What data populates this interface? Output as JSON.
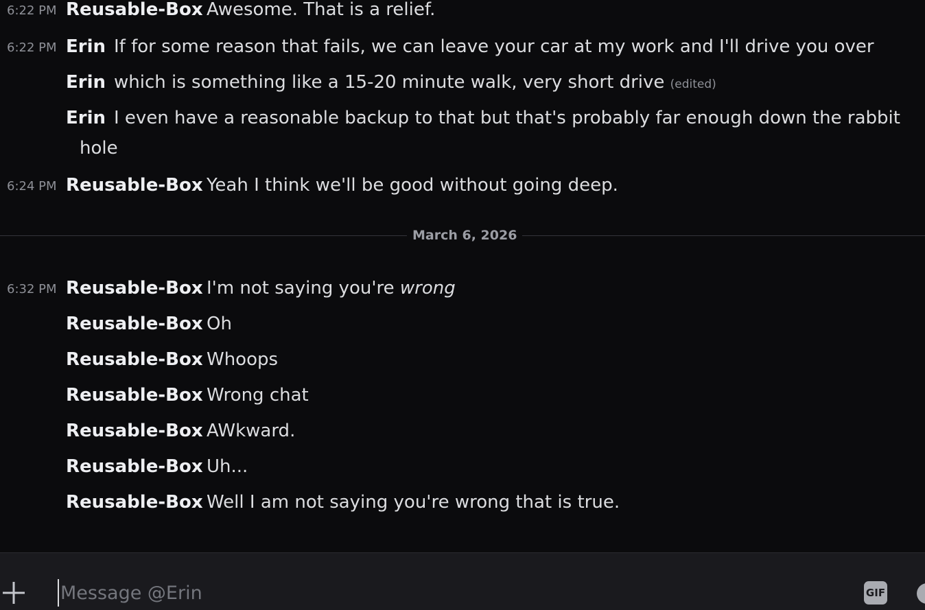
{
  "messages": [
    {
      "time": "6:22 PM",
      "author": "Reusable-Box",
      "text": "Awesome. That is a relief."
    },
    {
      "time": "6:22 PM",
      "author": "Erin",
      "text": "If for some reason that fails, we can leave your car at my work and I'll drive you over"
    },
    {
      "time": "",
      "author": "Erin",
      "text": "which is something like a 15-20 minute walk, very short drive",
      "edited": "(edited)"
    },
    {
      "time": "",
      "author": "Erin",
      "text": "I even have a reasonable backup to that but that's probably far enough down the rabbit",
      "continuation": "hole"
    },
    {
      "time": "6:24 PM",
      "author": "Reusable-Box",
      "text": "Yeah I think we'll be good without going deep."
    },
    {
      "time": "6:32 PM",
      "author": "Reusable-Box",
      "text_prefix": "I'm not saying you're ",
      "text_emphasis": "wrong"
    },
    {
      "time": "",
      "author": "Reusable-Box",
      "text": "Oh"
    },
    {
      "time": "",
      "author": "Reusable-Box",
      "text": "Whoops"
    },
    {
      "time": "",
      "author": "Reusable-Box",
      "text": "Wrong chat"
    },
    {
      "time": "",
      "author": "Reusable-Box",
      "text": "AWkward."
    },
    {
      "time": "",
      "author": "Reusable-Box",
      "text": "Uh..."
    },
    {
      "time": "",
      "author": "Reusable-Box",
      "text": "Well I am not saying you're wrong that is true."
    }
  ],
  "date_divider": "March 6, 2026",
  "composer": {
    "placeholder": "Message @Erin",
    "gif_label": "GIF",
    "plus_icon": "plus-icon",
    "emoji_icon": "emoji-icon"
  },
  "colors": {
    "background": "#0b0b0d",
    "composer_bg": "#1a1a1e",
    "author": "#eeeff2",
    "text": "#dcdde0",
    "muted": "#8e9097"
  }
}
